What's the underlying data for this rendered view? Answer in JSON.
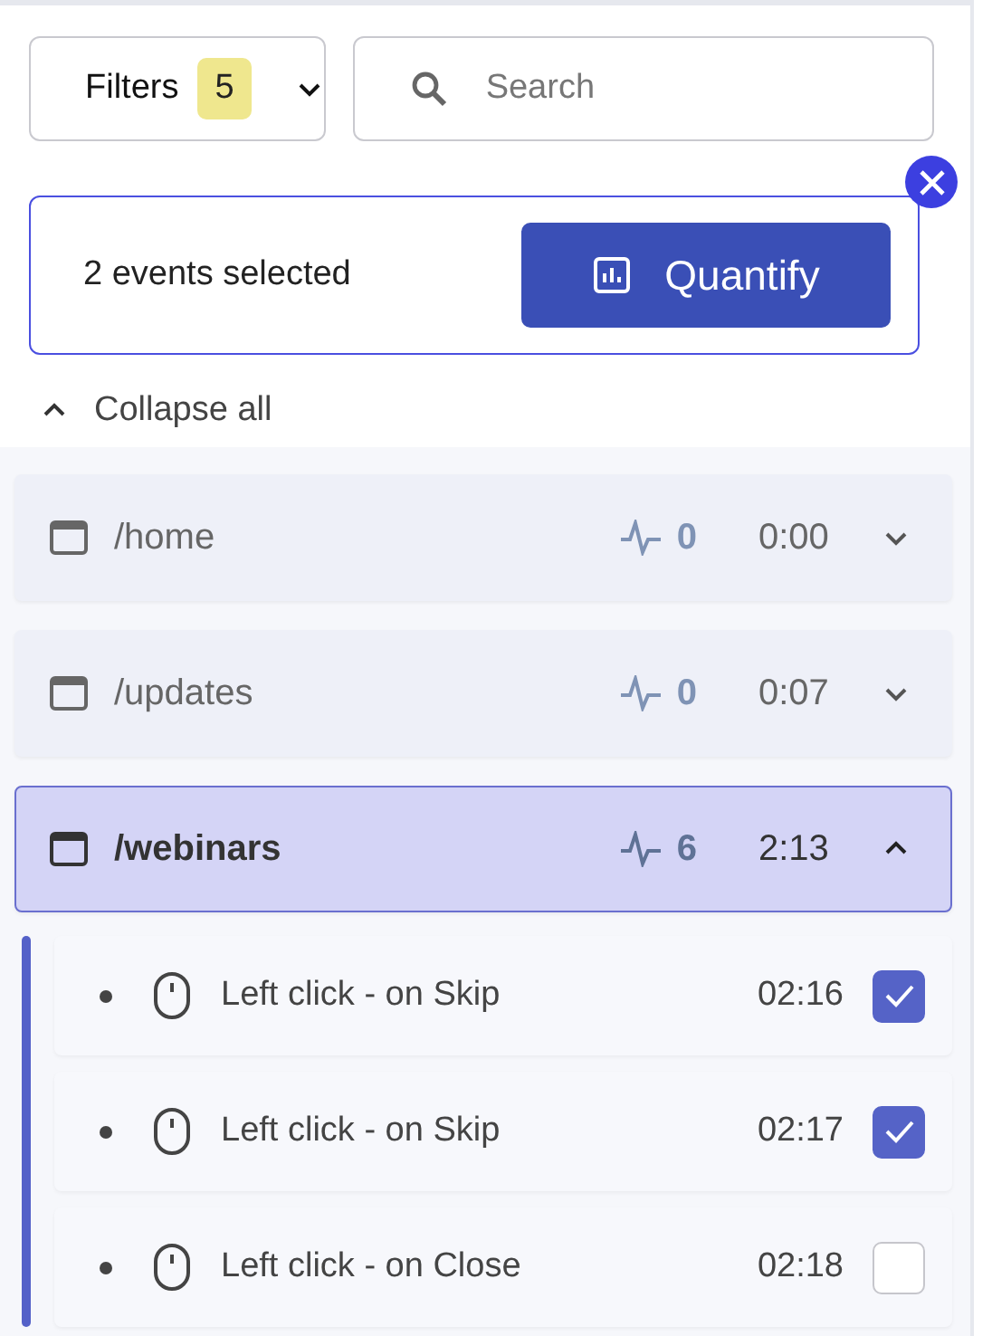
{
  "filters": {
    "label": "Filters",
    "count": "5"
  },
  "search": {
    "placeholder": "Search"
  },
  "selection": {
    "text": "2 events selected",
    "action": "Quantify"
  },
  "collapse": {
    "label": "Collapse all"
  },
  "pages": [
    {
      "path": "/home",
      "events": "0",
      "time": "0:00",
      "expanded": false
    },
    {
      "path": "/updates",
      "events": "0",
      "time": "0:07",
      "expanded": false
    },
    {
      "path": "/webinars",
      "events": "6",
      "time": "2:13",
      "expanded": true,
      "children": [
        {
          "label": "Left click - on Skip",
          "time": "02:16",
          "checked": true
        },
        {
          "label": "Left click - on Skip",
          "time": "02:17",
          "checked": true
        },
        {
          "label": "Left click - on Close",
          "time": "02:18",
          "checked": false
        }
      ]
    }
  ]
}
